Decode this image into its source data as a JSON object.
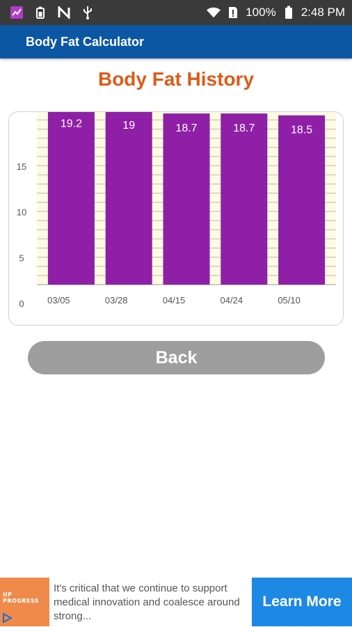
{
  "status_bar": {
    "battery_percent": "100%",
    "time": "2:48 PM"
  },
  "app_bar": {
    "title": "Body Fat Calculator"
  },
  "page": {
    "title": "Body Fat History",
    "back_label": "Back"
  },
  "colors": {
    "app_bar": "#0b57a3",
    "title": "#de5a18",
    "bar": "#8e1fa6",
    "plot_bg": "#fefbe2",
    "button": "#9e9e9e",
    "ad_cta": "#1e88e5"
  },
  "ad": {
    "logo_text": "UP\nPROGRESS",
    "body": "It's critical that we continue to support medical innovation and coalesce around strong...",
    "cta_label": "Learn More"
  },
  "chart_data": {
    "type": "bar",
    "title": "",
    "xlabel": "",
    "ylabel": "",
    "categories": [
      "03/05",
      "03/28",
      "04/15",
      "04/24",
      "05/10"
    ],
    "values": [
      19.2,
      19,
      18.7,
      18.7,
      18.5
    ],
    "value_labels": [
      "19.2",
      "19",
      "18.7",
      "18.7",
      "18.5"
    ],
    "y_ticks": [
      0,
      5,
      10,
      15
    ],
    "y_tick_labels": [
      "0",
      "5",
      "10",
      "15"
    ],
    "ylim": [
      0,
      20
    ],
    "grid": true,
    "legend": "none"
  }
}
